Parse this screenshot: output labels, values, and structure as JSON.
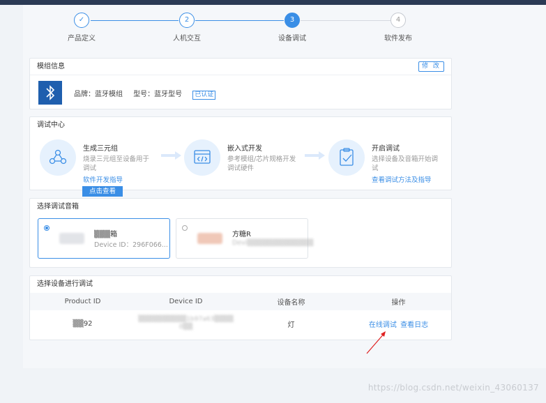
{
  "stepper": {
    "steps": [
      {
        "num": "",
        "label": "产品定义",
        "state": "done"
      },
      {
        "num": "2",
        "label": "人机交互",
        "state": "done"
      },
      {
        "num": "3",
        "label": "设备调试",
        "state": "active"
      },
      {
        "num": "4",
        "label": "软件发布",
        "state": "pending"
      }
    ],
    "check_glyph": "✓"
  },
  "module_info": {
    "title": "模组信息",
    "edit_label": "修 改",
    "brand": "品牌：蓝牙模组",
    "model": "型号：蓝牙型号",
    "certified": "已认证",
    "logo_icon": "bluetooth-icon"
  },
  "debug_center": {
    "title": "调试中心",
    "items": [
      {
        "title": "生成三元组",
        "desc": "烧录三元组至设备用于调试",
        "link": "软件开发指导",
        "icon": "network-icon"
      },
      {
        "title": "嵌入式开发",
        "desc": "参考模组/芯片规格开发调试硬件",
        "link": "",
        "icon": "code-window-icon"
      },
      {
        "title": "开启调试",
        "desc": "选择设备及音箱开始调试",
        "link": "查看调试方法及指导",
        "icon": "clipboard-check-icon"
      }
    ],
    "view_button": "点击查看"
  },
  "speakers": {
    "title": "选择调试音箱",
    "items": [
      {
        "name": "▒▒▒箱",
        "id": "Device ID：296F066...",
        "selected": true
      },
      {
        "name": "方糖R",
        "id": "Devi▒▒▒▒▒▒▒▒▒▒▒▒▒",
        "selected": false
      }
    ]
  },
  "devices": {
    "title": "选择设备进行调试",
    "columns": [
      "Product ID",
      "Device ID",
      "设备名称",
      "操作"
    ],
    "rows": [
      {
        "product_id": "▒▒92",
        "device_id_line1": "▒▒▒▒▒▒▒▒▒▒1b97a63▒▒▒▒",
        "device_id_line2": "0▒▒",
        "name": "灯",
        "action_debug": "在线调试",
        "action_log": "查看日志"
      }
    ]
  },
  "watermark": "https://blog.csdn.net/weixin_43060137",
  "colors": {
    "accent": "#3a8ee6",
    "topbar": "#2b3a55",
    "annotation": "#e02020"
  }
}
